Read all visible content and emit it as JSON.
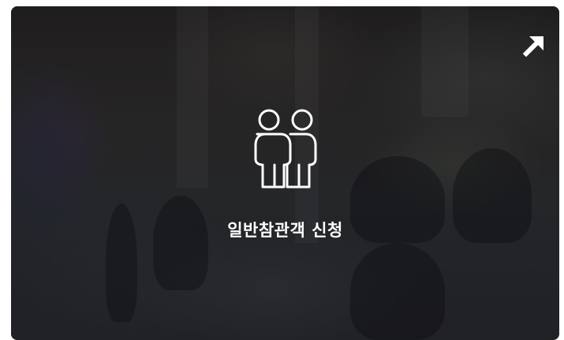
{
  "card": {
    "title": "일반참관객 신청",
    "icon": "people-icon",
    "link_icon": "arrow-up-right-icon",
    "overlay_color": "#0a0a0c",
    "text_color": "#ffffff"
  }
}
